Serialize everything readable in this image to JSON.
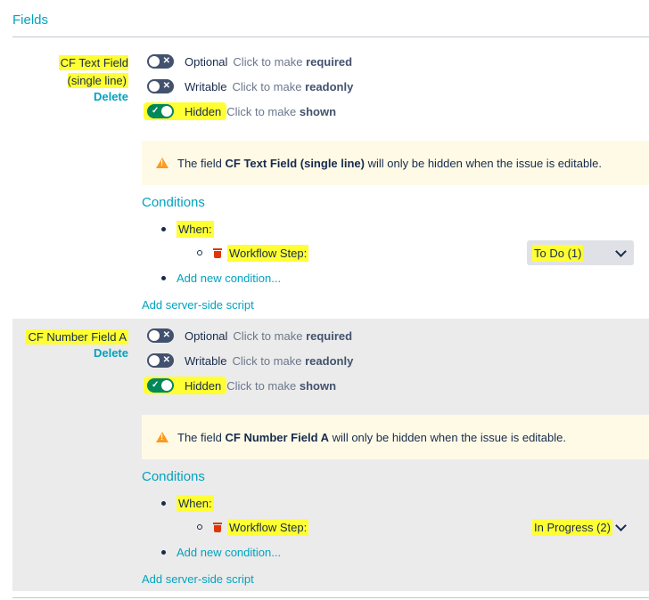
{
  "section_title": "Fields",
  "fields": [
    {
      "name": "CF Text Field (single line)",
      "delete_label": "Delete",
      "toggles": [
        {
          "label": "Optional",
          "hint_prefix": "Click to make",
          "hint_action": "required",
          "on": false
        },
        {
          "label": "Writable",
          "hint_prefix": "Click to make",
          "hint_action": "readonly",
          "on": false
        },
        {
          "label": "Hidden",
          "hint_prefix": "Click to make",
          "hint_action": "shown",
          "on": true
        }
      ],
      "warning": {
        "prefix": "The field",
        "field": "CF Text Field (single line)",
        "suffix": "will only be hidden when the issue is editable."
      },
      "conditions_title": "Conditions",
      "when_label": "When:",
      "condition": {
        "label": "Workflow Step:",
        "value": "To Do (1)"
      },
      "add_condition": "Add new condition...",
      "add_script": "Add server-side script"
    },
    {
      "name": "CF Number Field A",
      "delete_label": "Delete",
      "toggles": [
        {
          "label": "Optional",
          "hint_prefix": "Click to make",
          "hint_action": "required",
          "on": false
        },
        {
          "label": "Writable",
          "hint_prefix": "Click to make",
          "hint_action": "readonly",
          "on": false
        },
        {
          "label": "Hidden",
          "hint_prefix": "Click to make",
          "hint_action": "shown",
          "on": true
        }
      ],
      "warning": {
        "prefix": "The field",
        "field": "CF Number Field A",
        "suffix": "will only be hidden when the issue is editable."
      },
      "conditions_title": "Conditions",
      "when_label": "When:",
      "condition": {
        "label": "Workflow Step:",
        "value": "In Progress (2)"
      },
      "add_condition": "Add new condition...",
      "add_script": "Add server-side script"
    }
  ],
  "colors": {
    "accent": "#00a3bf",
    "highlight": "#ffff33",
    "toggle_on": "#00875a",
    "toggle_off": "#42526e",
    "warning_bg": "#fffae6",
    "warning_icon": "#ff991f",
    "trash": "#de350b"
  }
}
